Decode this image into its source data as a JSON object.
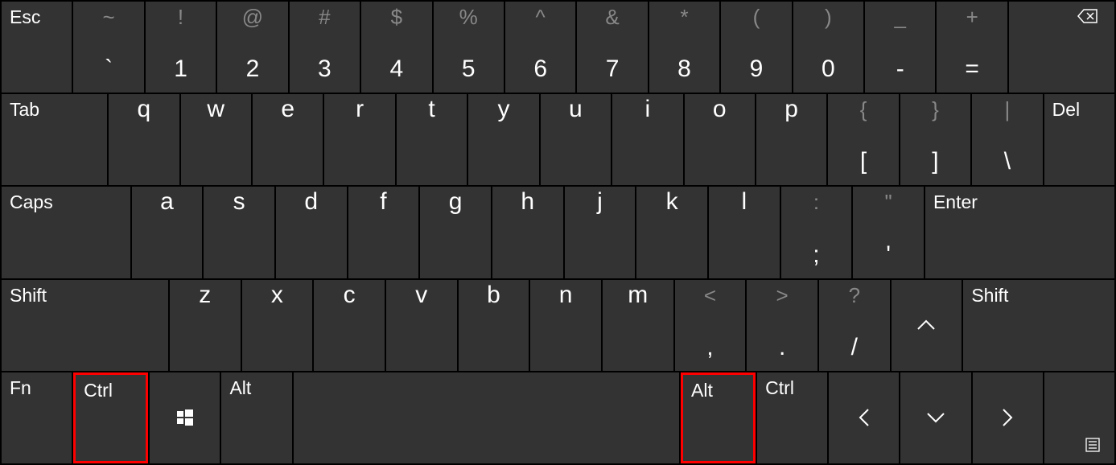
{
  "row1": {
    "esc": "Esc",
    "tilde": {
      "upper": "~",
      "lower": "`"
    },
    "n1": {
      "upper": "!",
      "lower": "1"
    },
    "n2": {
      "upper": "@",
      "lower": "2"
    },
    "n3": {
      "upper": "#",
      "lower": "3"
    },
    "n4": {
      "upper": "$",
      "lower": "4"
    },
    "n5": {
      "upper": "%",
      "lower": "5"
    },
    "n6": {
      "upper": "^",
      "lower": "6"
    },
    "n7": {
      "upper": "&",
      "lower": "7"
    },
    "n8": {
      "upper": "*",
      "lower": "8"
    },
    "n9": {
      "upper": "(",
      "lower": "9"
    },
    "n0": {
      "upper": ")",
      "lower": "0"
    },
    "minus": {
      "upper": "_",
      "lower": "-"
    },
    "equals": {
      "upper": "+",
      "lower": "="
    }
  },
  "row2": {
    "tab": "Tab",
    "q": "q",
    "w": "w",
    "e": "e",
    "r": "r",
    "t": "t",
    "y": "y",
    "u": "u",
    "i": "i",
    "o": "o",
    "p": "p",
    "lbracket": {
      "upper": "{",
      "lower": "["
    },
    "rbracket": {
      "upper": "}",
      "lower": "]"
    },
    "backslash": {
      "upper": "|",
      "lower": "\\"
    },
    "del": "Del"
  },
  "row3": {
    "caps": "Caps",
    "a": "a",
    "s": "s",
    "d": "d",
    "f": "f",
    "g": "g",
    "h": "h",
    "j": "j",
    "k": "k",
    "l": "l",
    "semicolon": {
      "upper": ":",
      "lower": ";"
    },
    "quote": {
      "upper": "\"",
      "lower": "'"
    },
    "enter": "Enter"
  },
  "row4": {
    "lshift": "Shift",
    "z": "z",
    "x": "x",
    "c": "c",
    "v": "v",
    "b": "b",
    "n": "n",
    "m": "m",
    "comma": {
      "upper": "<",
      "lower": ","
    },
    "period": {
      "upper": ">",
      "lower": "."
    },
    "slash": {
      "upper": "?",
      "lower": "/"
    },
    "rshift": "Shift"
  },
  "row5": {
    "fn": "Fn",
    "lctrl": "Ctrl",
    "lalt": "Alt",
    "ralt": "Alt",
    "rctrl": "Ctrl"
  },
  "highlighted_keys": [
    "lctrl",
    "ralt"
  ]
}
